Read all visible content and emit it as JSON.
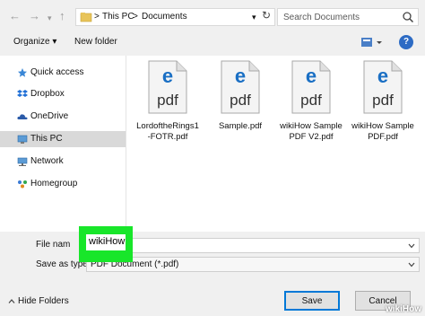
{
  "address_bar": {
    "segments": [
      "This PC",
      "Documents"
    ],
    "separator": ">"
  },
  "search": {
    "placeholder": "Search Documents"
  },
  "toolbar": {
    "organize_label": "Organize ▾",
    "new_folder_label": "New folder",
    "help_label": "?"
  },
  "sidebar": {
    "items": [
      {
        "label": "Quick access",
        "icon": "star-icon",
        "selected": false
      },
      {
        "label": "Dropbox",
        "icon": "dropbox-icon",
        "selected": false
      },
      {
        "label": "OneDrive",
        "icon": "cloud-icon",
        "selected": false
      },
      {
        "label": "This PC",
        "icon": "computer-icon",
        "selected": true
      },
      {
        "label": "Network",
        "icon": "network-icon",
        "selected": false
      },
      {
        "label": "Homegroup",
        "icon": "homegroup-icon",
        "selected": false
      }
    ]
  },
  "files": [
    {
      "name": "LordoftheRings1\n-FOTR.pdf",
      "icon": "pdf-icon"
    },
    {
      "name": "Sample.pdf",
      "icon": "pdf-icon"
    },
    {
      "name": "wikiHow Sample\nPDF V2.pdf",
      "icon": "pdf-icon"
    },
    {
      "name": "wikiHow Sample\nPDF.pdf",
      "icon": "pdf-icon"
    }
  ],
  "pdf_label": "pdf",
  "form": {
    "file_name_label": "File nam",
    "file_name_value": "wikiHow",
    "save_as_type_label": "Save as type:",
    "save_as_type_value": "PDF Document (*.pdf)"
  },
  "buttons": {
    "save": "Save",
    "cancel": "Cancel",
    "hide_folders": "Hide Folders"
  },
  "watermark": "wikiHow",
  "colors": {
    "highlight": "#18e62a",
    "pdf_blue": "#1a6fc4",
    "selected_bg": "#d9d9d9"
  }
}
